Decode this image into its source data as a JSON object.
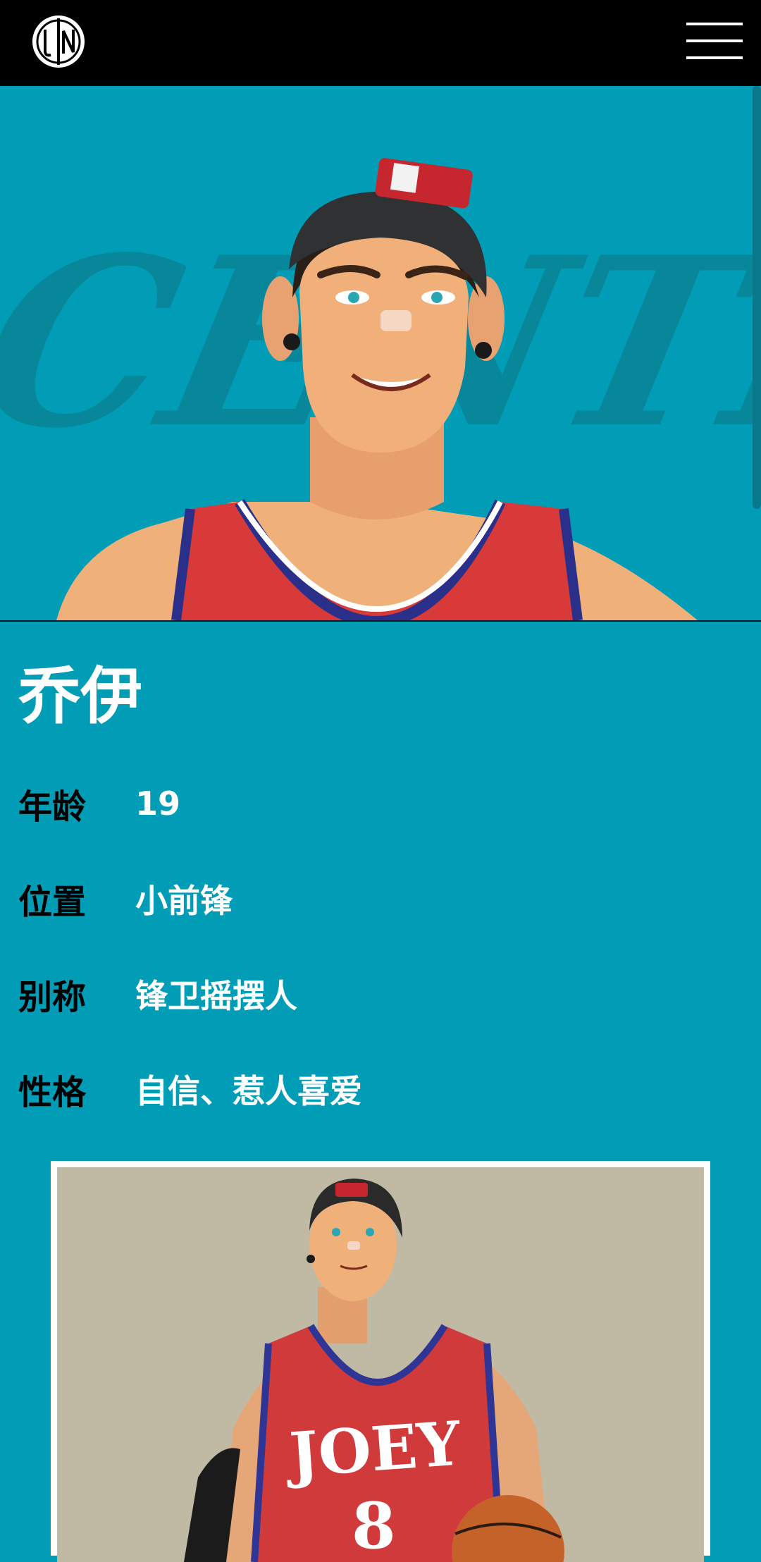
{
  "header": {
    "logo_icon": "jn-logo-icon",
    "menu_icon": "hamburger-menu-icon"
  },
  "hero": {
    "background_text": "CENTER",
    "background_color": "#019cb6"
  },
  "character": {
    "name": "乔伊",
    "info": [
      {
        "label": "年龄",
        "value": "19"
      },
      {
        "label": "位置",
        "value": "小前锋"
      },
      {
        "label": "别称",
        "value": "锋卫摇摆人"
      },
      {
        "label": "性格",
        "value": "自信、惹人喜爱"
      }
    ],
    "jersey_text": "JOEY",
    "jersey_number": "8"
  },
  "colors": {
    "page_bg": "#019cb6",
    "header_bg": "#000000",
    "label_color": "#000000",
    "value_color": "#ffffff",
    "photo_bg": "#c0b9a4"
  }
}
